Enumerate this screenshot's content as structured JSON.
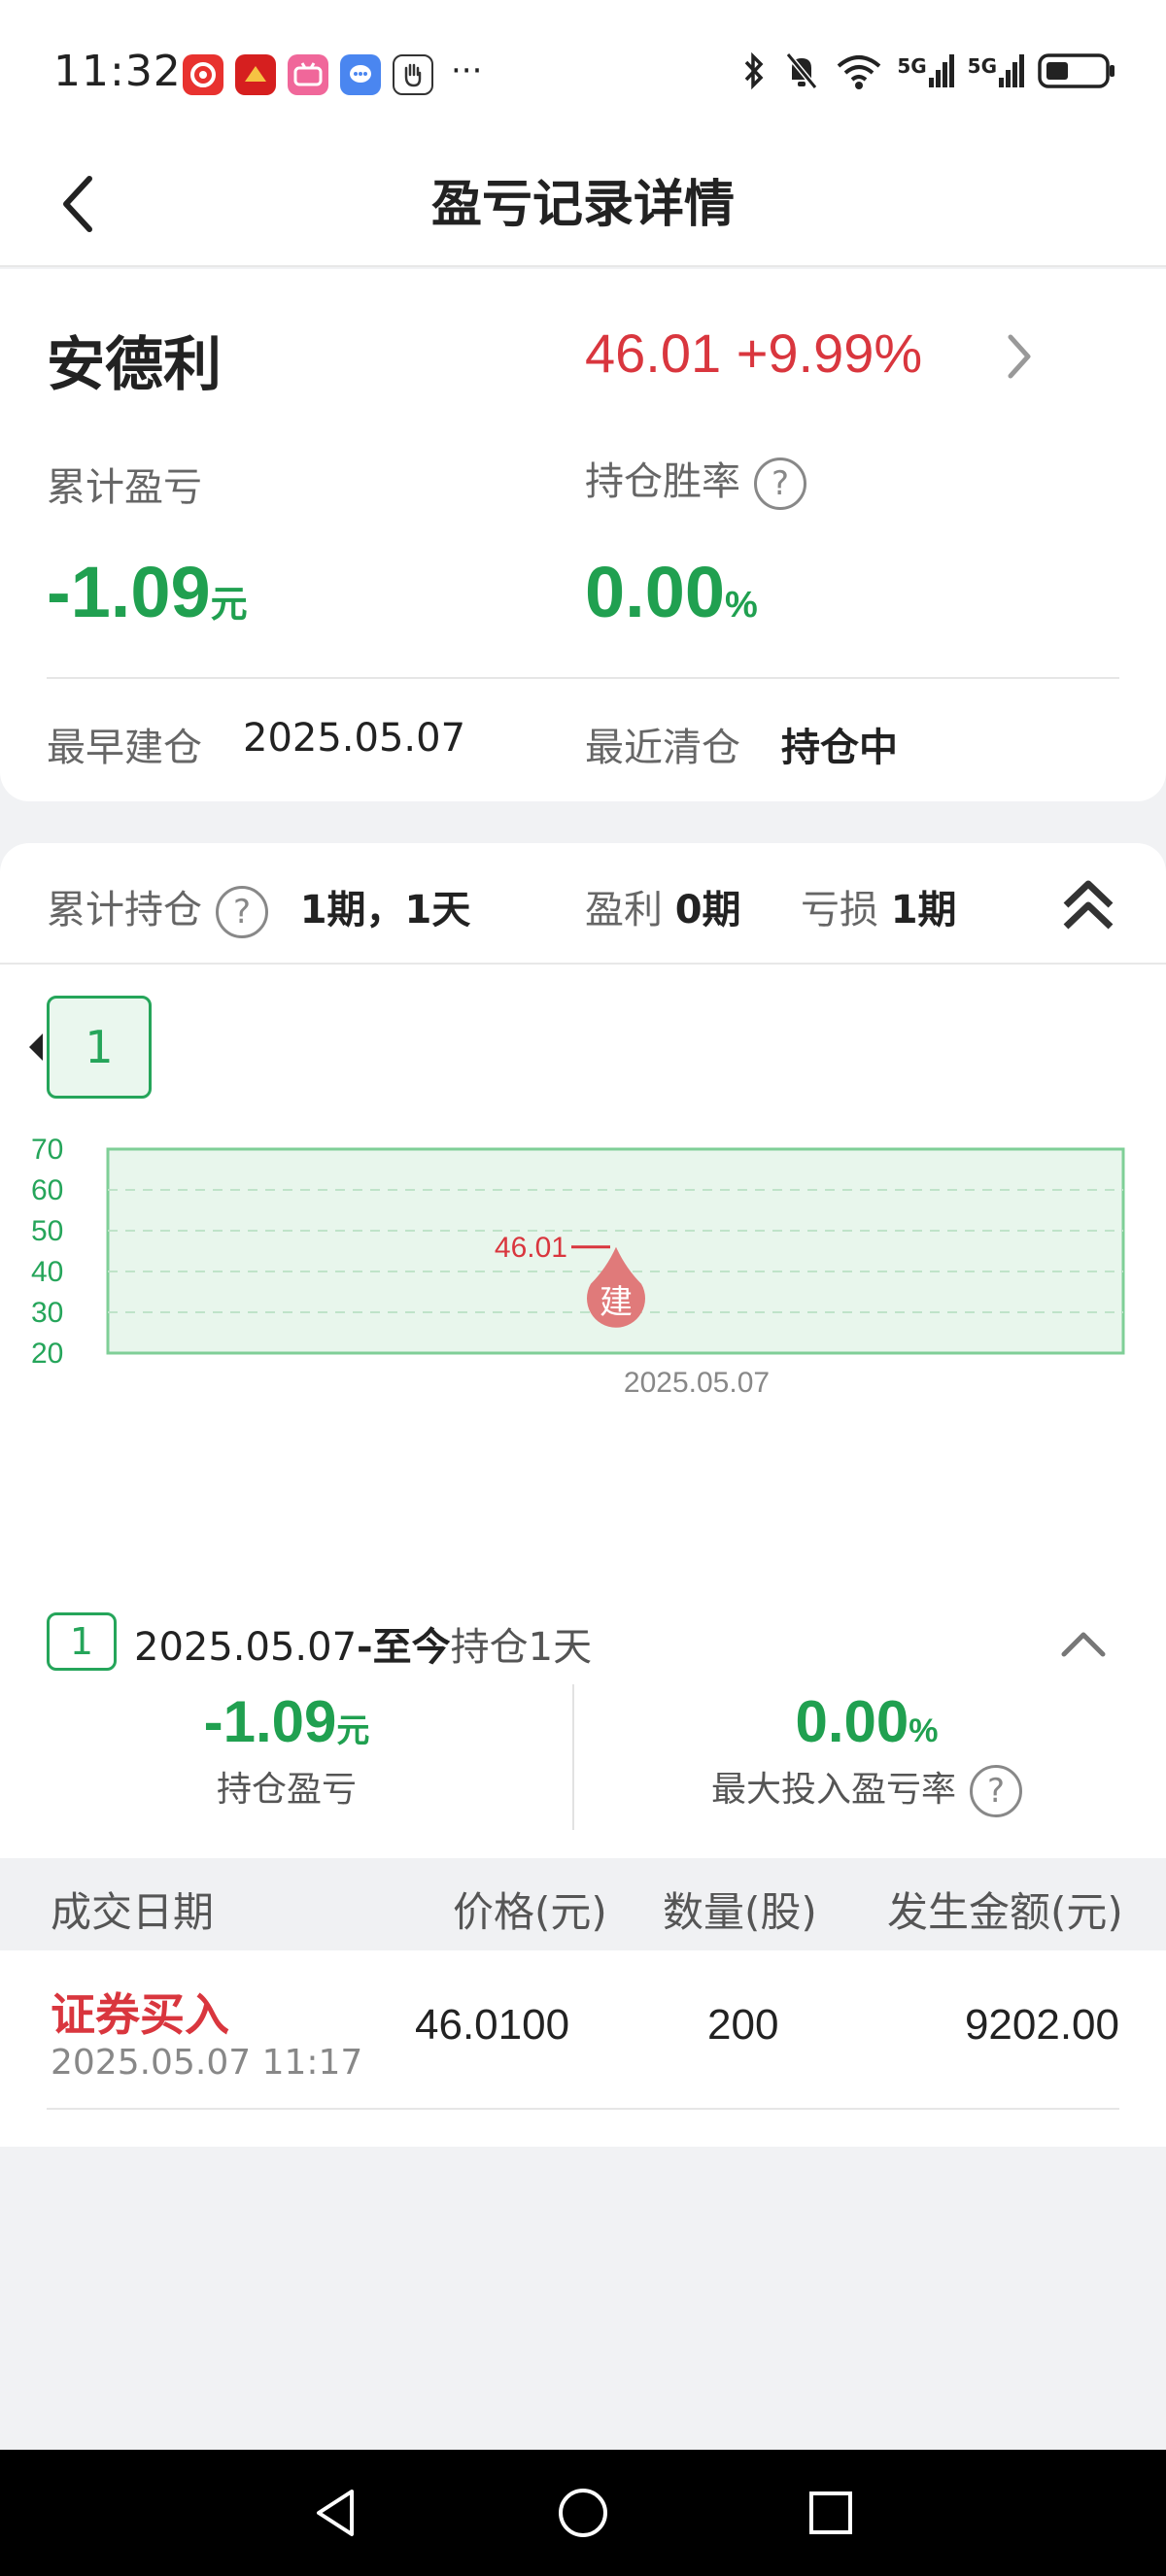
{
  "status_bar": {
    "time": "11:32",
    "more": "···",
    "network1": "5G",
    "network2": "5G",
    "app_icons": [
      "app-red-icon",
      "news-app-icon",
      "bilibili-icon",
      "message-app-icon",
      "hand-stop-icon"
    ]
  },
  "header": {
    "title": "盈亏记录详情"
  },
  "stock": {
    "name": "安德利",
    "price_change": "46.01 +9.99%"
  },
  "summary": {
    "cum_pnl_label": "累计盈亏",
    "cum_pnl_value": "-1.09",
    "cum_pnl_unit": "元",
    "win_rate_label": "持仓胜率",
    "win_rate_value": "0.00",
    "win_rate_unit": "%",
    "earliest_label": "最早建仓",
    "earliest_value": "2025.05.07",
    "recent_label": "最近清仓",
    "recent_value": "持仓中",
    "help": "?"
  },
  "holdings": {
    "label": "累计持仓",
    "value": "1期，1天",
    "profit_label": "盈利",
    "profit_value": "0期",
    "loss_label": "亏损",
    "loss_value": "1期"
  },
  "period_tab": "1",
  "chart_data": {
    "type": "line",
    "y_ticks": [
      "70",
      "60",
      "50",
      "40",
      "30",
      "20"
    ],
    "ylim": [
      20,
      70
    ],
    "x_label": "2025.05.07",
    "marker": {
      "label": "建",
      "price": 46.01,
      "price_text": "46.01"
    },
    "grid": true,
    "colors": {
      "fill": "#e8f6ec",
      "border": "#7fcf97",
      "marker": "#e07a7a",
      "price": "#d9363e"
    }
  },
  "segment": {
    "badge": "1",
    "range_start": "2025.05.07",
    "range_end": "-至今",
    "duration": "持仓1天",
    "pnl_value": "-1.09",
    "pnl_unit": "元",
    "pnl_label": "持仓盈亏",
    "rate_value": "0.00",
    "rate_unit": "%",
    "rate_label": "最大投入盈亏率"
  },
  "table": {
    "headers": [
      "成交日期",
      "价格(元)",
      "数量(股)",
      "发生金额(元)"
    ],
    "rows": [
      {
        "type": "证券买入",
        "time": "2025.05.07 11:17",
        "price": "46.0100",
        "qty": "200",
        "amount": "9202.00"
      }
    ]
  }
}
